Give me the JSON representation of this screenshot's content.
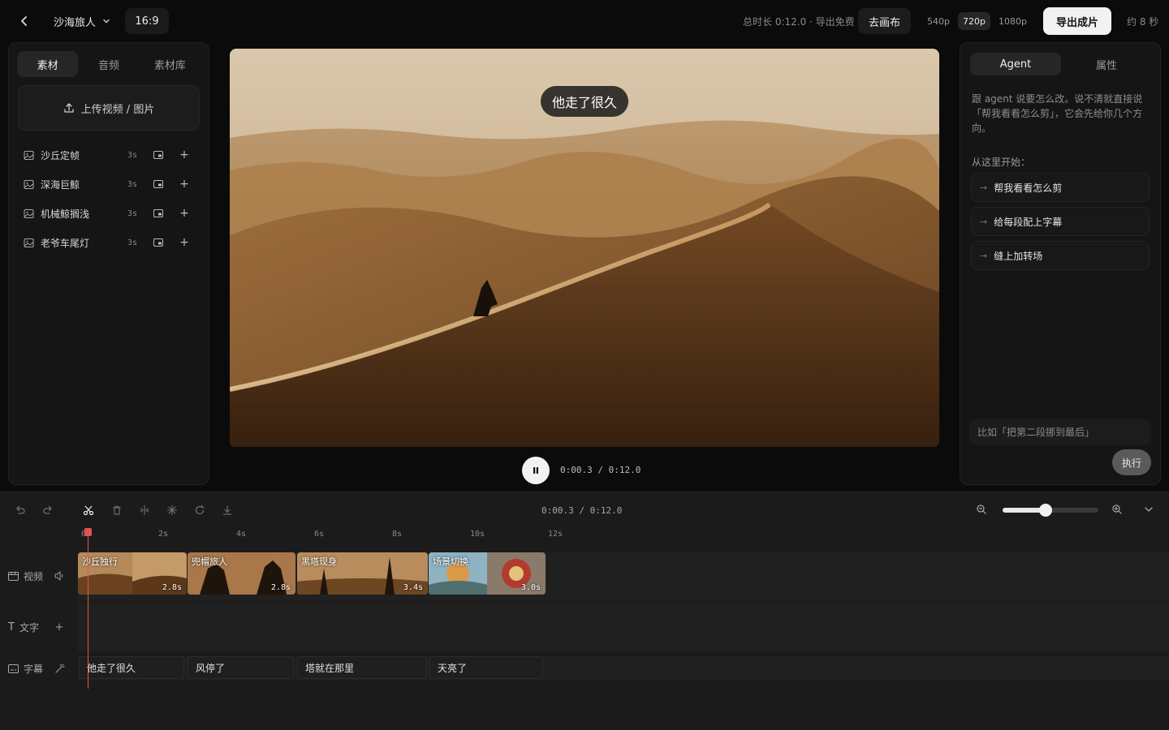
{
  "topbar": {
    "project_name": "沙海旅人",
    "aspect_ratio": "16:9",
    "duration_info": "总时长 0:12.0 · 导出免费",
    "canvas_button": "去画布",
    "resolutions": [
      "540p",
      "720p",
      "1080p"
    ],
    "resolution_selected": "720p",
    "export_button": "导出成片",
    "eta": "约 8 秒"
  },
  "left": {
    "tabs": [
      "素材",
      "音频",
      "素材库"
    ],
    "active_tab": "素材",
    "upload_label": "上传视频 / 图片",
    "assets": [
      {
        "name": "沙丘定帧",
        "duration": "3s"
      },
      {
        "name": "深海巨鲸",
        "duration": "3s"
      },
      {
        "name": "机械鲸搁浅",
        "duration": "3s"
      },
      {
        "name": "老爷车尾灯",
        "duration": "3s"
      }
    ]
  },
  "preview": {
    "caption": "他走了很久",
    "current_time": "0:00.3",
    "total_time": "0:12.0",
    "time_readout": "0:00.3 / 0:12.0"
  },
  "right": {
    "tabs": [
      "Agent",
      "属性"
    ],
    "active_tab": "Agent",
    "intro": "跟 agent 说要怎么改。说不清就直接说「帮我看看怎么剪」，它会先给你几个方向。",
    "start_label": "从这里开始：",
    "suggestions": [
      "帮我看看怎么剪",
      "给每段配上字幕",
      "缝上加转场"
    ],
    "input_placeholder": "比如「把第二段挪到最后」",
    "run_button": "执行"
  },
  "timeline": {
    "time_readout": "0:00.3 / 0:12.0",
    "zoom_level": 0.45,
    "ruler_ticks": [
      "0s",
      "2s",
      "4s",
      "6s",
      "8s",
      "10s",
      "12s"
    ],
    "tracks": {
      "video": {
        "label": "视频"
      },
      "text": {
        "label": "文字"
      },
      "subtitle": {
        "label": "字幕"
      }
    },
    "video_clips": [
      {
        "label": "沙丘独行",
        "duration": "2.8s"
      },
      {
        "label": "兜帽旅人",
        "duration": "2.8s"
      },
      {
        "label": "黑塔现身",
        "duration": "3.4s"
      },
      {
        "label": "场景切换",
        "duration": "3.0s"
      }
    ],
    "subtitles": [
      "他走了很久",
      "风停了",
      "塔就在那里",
      "天亮了"
    ]
  },
  "colors": {
    "accent_playhead": "#e0564c",
    "export_bg": "#f2f2f2",
    "panel_bg": "#151515"
  }
}
